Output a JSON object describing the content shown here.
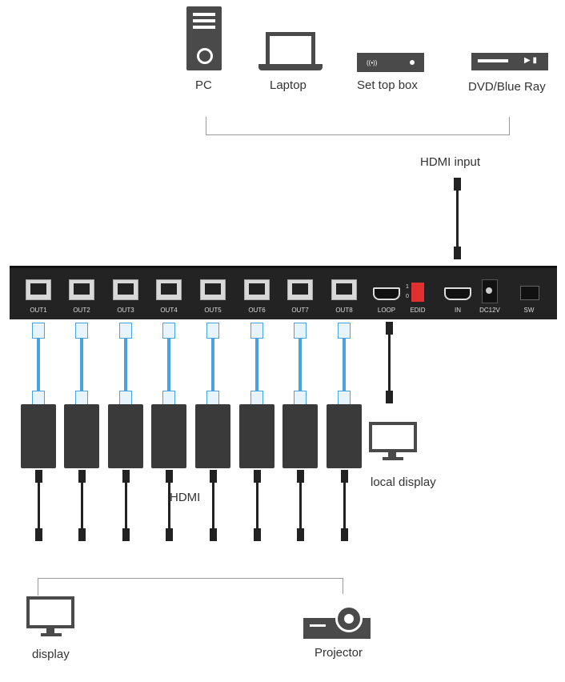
{
  "sources": [
    {
      "label": "PC",
      "icon": "pc-tower-icon"
    },
    {
      "label": "Laptop",
      "icon": "laptop-icon"
    },
    {
      "label": "Set top box",
      "icon": "set-top-box-icon"
    },
    {
      "label": "DVD/Blue Ray",
      "icon": "dvd-player-icon"
    }
  ],
  "hdmi_input_label": "HDMI input",
  "hub": {
    "ports": [
      "OUT1",
      "OUT2",
      "OUT3",
      "OUT4",
      "OUT5",
      "OUT6",
      "OUT7",
      "OUT8"
    ],
    "loop": "LOOP",
    "edid": "EDID",
    "edid_1": "1",
    "edid_0": "0",
    "in": "IN",
    "dc": "DC12V",
    "sw": "SW"
  },
  "hdmi_label": "HDMI",
  "local_display_label": "local display",
  "outputs": [
    {
      "label": "display",
      "icon": "monitor-icon"
    },
    {
      "label": "Projector",
      "icon": "projector-icon"
    }
  ],
  "colors": {
    "cat_cable": "#4aa3e0",
    "device": "#232323",
    "edid_switch": "#e03030"
  }
}
